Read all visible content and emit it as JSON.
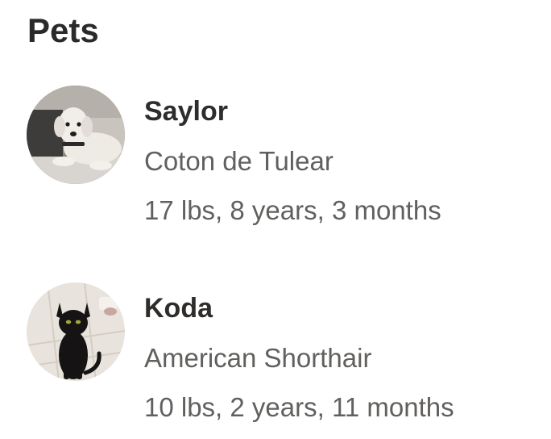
{
  "section": {
    "title": "Pets"
  },
  "pets": [
    {
      "name": "Saylor",
      "breed": "Coton de Tulear",
      "stats": "17 lbs, 8 years, 3 months",
      "avatar_icon": "dog-photo"
    },
    {
      "name": "Koda",
      "breed": "American Shorthair",
      "stats": "10 lbs, 2 years, 11 months",
      "avatar_icon": "cat-photo"
    }
  ]
}
